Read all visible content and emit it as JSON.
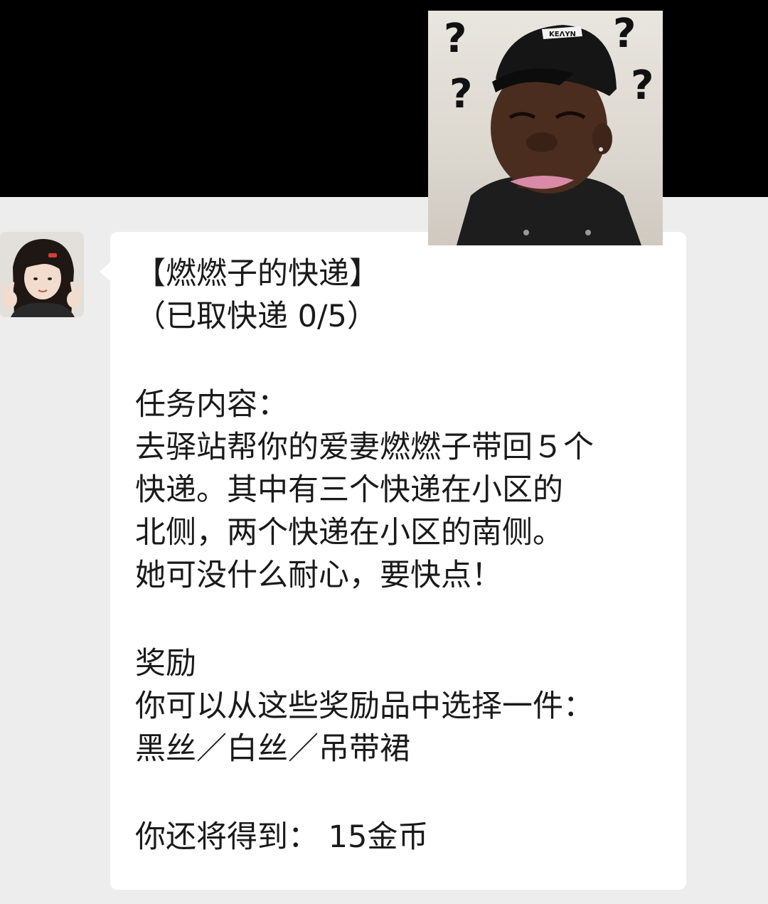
{
  "message": {
    "title": "【燃燃子的快递】",
    "progress": "（已取快递  0/5）",
    "task_heading": "任务内容：",
    "task_lines": [
      "去驿站帮你的爱妻燃燃子带回５个",
      "快递。其中有三个快递在小区的",
      "北侧，两个快递在小区的南侧。",
      "她可没什么耐心，要快点！"
    ],
    "reward_heading": "奖励",
    "reward_intro": "你可以从这些奖励品中选择一件：",
    "reward_options": "黑丝／白丝／吊带裙",
    "coins": "你还将得到：  15金币"
  },
  "meme": {
    "marks": [
      "?",
      "?",
      "?",
      "?"
    ]
  },
  "colors": {
    "top_band": "#000000",
    "chat_background": "#ededed",
    "bubble": "#ffffff",
    "text": "#1a1a1a"
  }
}
